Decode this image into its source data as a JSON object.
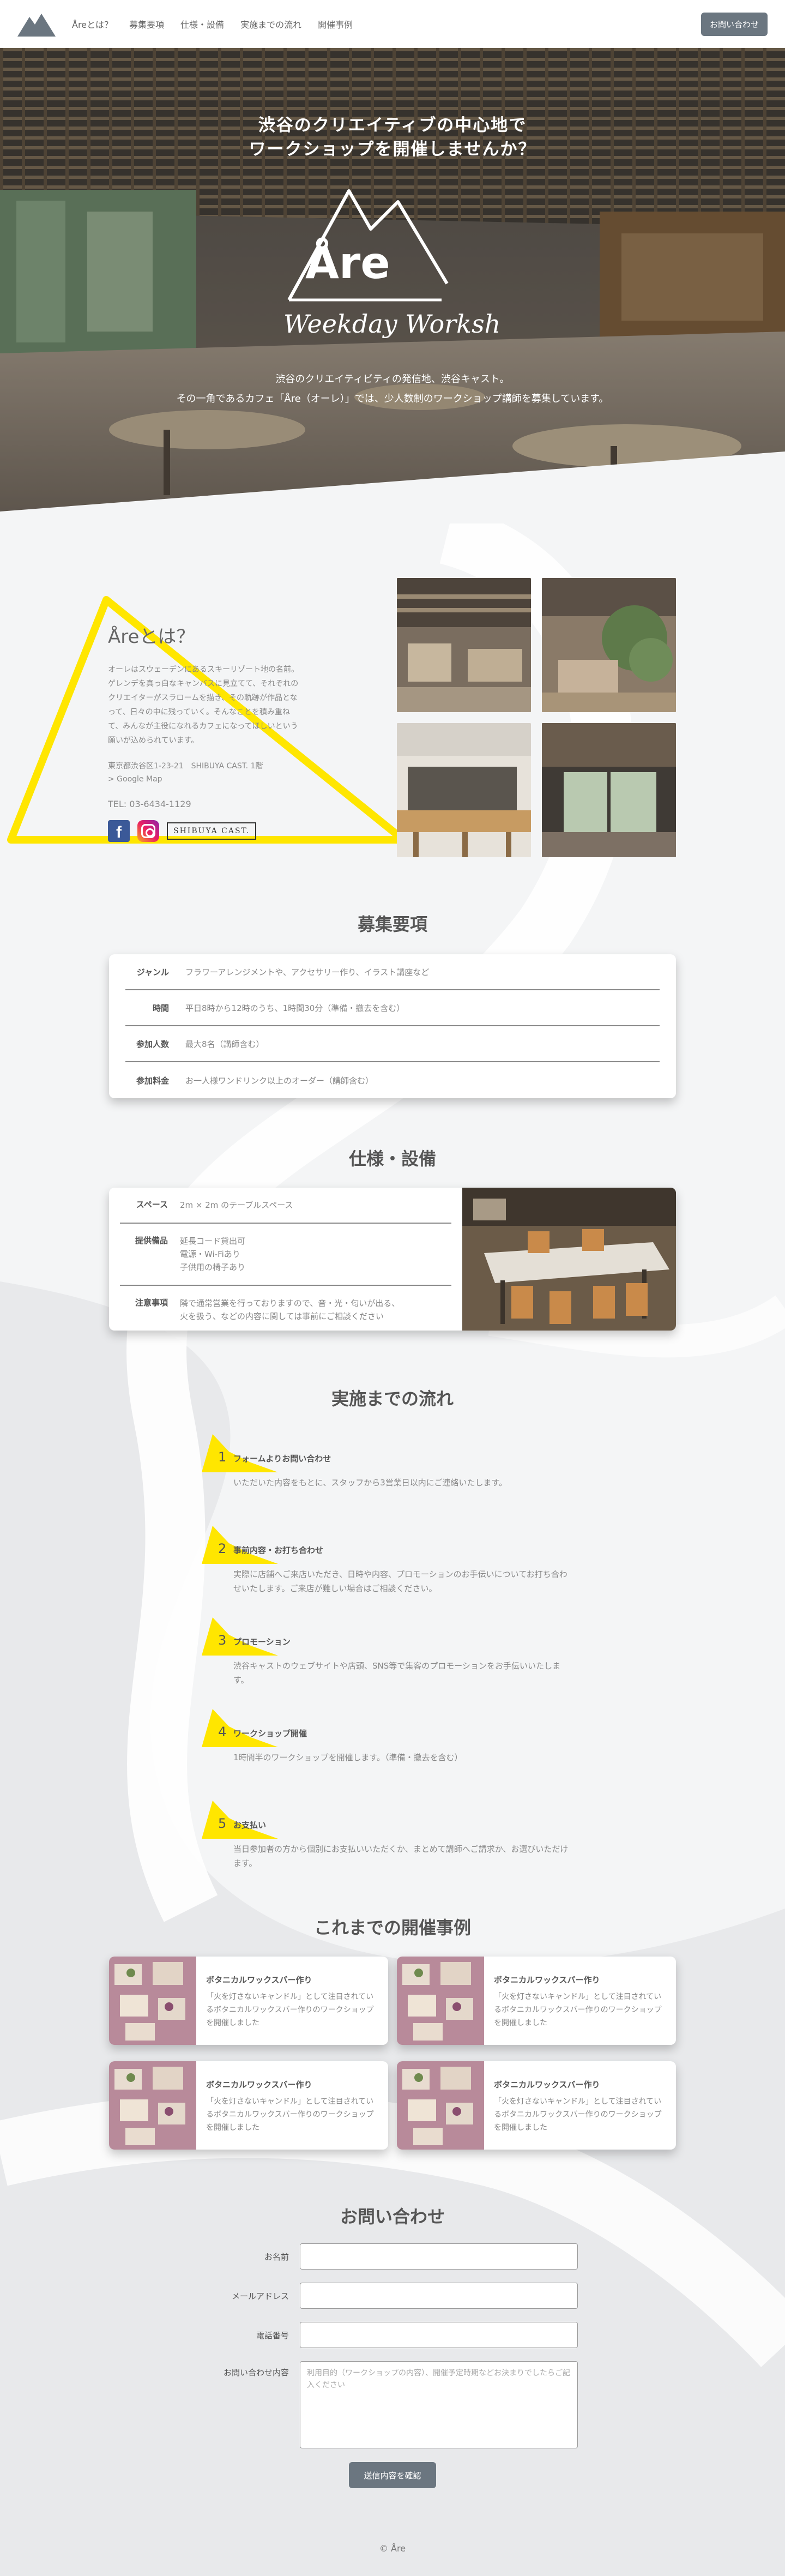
{
  "header": {
    "logo": "mountain-logo",
    "nav": [
      "Åreとは？",
      "募集要項",
      "仕様・設備",
      "実施までの流れ",
      "開催事例"
    ],
    "contact_button": "お問い合わせ"
  },
  "hero": {
    "title_line1": "渋谷のクリエイティブの中心地で",
    "title_line2": "ワークショップを開催しませんか？",
    "emblem_name": "Åre",
    "emblem_sub": "Weekday Workshop",
    "desc_line1": "渋谷のクリエイティビティの発信地、渋谷キャスト。",
    "desc_line2": "その一角であるカフェ「Åre（オーレ）」では、少人数制のワークショップ講師を募集しています。"
  },
  "about": {
    "title": "Åreとは？",
    "body": "オーレはスウェーデンにあるスキーリゾート地の名前。ゲレンデを真っ白なキャンバスに見立てて、それぞれのクリエイターがスラロームを描き、その軌跡が作品となって、日々の中に残っていく。そんなことを積み重ねて、みんなが主役になれるカフェになってほしいという願いが込められています。",
    "address": "東京都渋谷区1-23-21　SHIBUYA CAST. 1階",
    "map_link": "> Google Map",
    "tel": "TEL: 03-6434-1129",
    "social": [
      "facebook-icon",
      "instagram-icon"
    ],
    "badge": "SHIBUYA CAST."
  },
  "recruit": {
    "title": "募集要項",
    "rows": [
      {
        "label": "ジャンル",
        "value": "フラワーアレンジメントや、アクセサリー作り、イラスト講座など"
      },
      {
        "label": "時間",
        "value": "平日8時から12時のうち、1時間30分（準備・撤去を含む）"
      },
      {
        "label": "参加人数",
        "value": "最大8名（講師含む）"
      },
      {
        "label": "参加料金",
        "value": "お一人様ワンドリンク以上のオーダー（講師含む）"
      }
    ]
  },
  "spec": {
    "title": "仕様・設備",
    "rows": [
      {
        "label": "スペース",
        "lines": [
          "2m × 2m のテーブルスペース"
        ]
      },
      {
        "label": "提供備品",
        "lines": [
          "延長コード貸出可",
          "電源・Wi-Fiあり",
          "子供用の椅子あり"
        ]
      },
      {
        "label": "注意事項",
        "lines": [
          "隣で通常営業を行っておりますので、音・光・匂いが出る、",
          "火を扱う、などの内容に関しては事前にご相談ください"
        ]
      }
    ]
  },
  "flow": {
    "title": "実施までの流れ",
    "steps": [
      {
        "num": "1",
        "name": "フォームよりお問い合わせ",
        "desc": "いただいた内容をもとに、スタッフから3営業日以内にご連絡いたします。"
      },
      {
        "num": "2",
        "name": "事前内容・お打ち合わせ",
        "desc": "実際に店舗へご来店いただき、日時や内容、プロモーションのお手伝いについてお打ち合わせいたします。ご来店が難しい場合はご相談ください。"
      },
      {
        "num": "3",
        "name": "プロモーション",
        "desc": "渋谷キャストのウェブサイトや店頭、SNS等で集客のプロモーションをお手伝いいたします。"
      },
      {
        "num": "4",
        "name": "ワークショップ開催",
        "desc": "1時間半のワークショップを開催します。（準備・撤去を含む）"
      },
      {
        "num": "5",
        "name": "お支払い",
        "desc": "当日参加者の方から個別にお支払いいただくか、まとめて講師へご請求か、お選びいただけます。"
      }
    ]
  },
  "cases": {
    "title": "これまでの開催事例",
    "items": [
      {
        "title": "ボタニカルワックスバー作り",
        "desc": "「火を灯さないキャンドル」として注目されているボタニカルワックスバー作りのワークショップを開催しました"
      },
      {
        "title": "ボタニカルワックスバー作り",
        "desc": "「火を灯さないキャンドル」として注目されているボタニカルワックスバー作りのワークショップを開催しました"
      },
      {
        "title": "ボタニカルワックスバー作り",
        "desc": "「火を灯さないキャンドル」として注目されているボタニカルワックスバー作りのワークショップを開催しました"
      },
      {
        "title": "ボタニカルワックスバー作り",
        "desc": "「火を灯さないキャンドル」として注目されているボタニカルワックスバー作りのワークショップを開催しました"
      }
    ]
  },
  "contact": {
    "title": "お問い合わせ",
    "name_label": "お名前",
    "email_label": "メールアドレス",
    "phone_label": "電話番号",
    "message_label": "お問い合わせ内容",
    "message_placeholder": "利用目的（ワークショップの内容）、開催予定時期などお決まりでしたらご記入ください",
    "submit": "送信内容を確認"
  },
  "footer": {
    "text": "© Åre"
  },
  "colors": {
    "accent_yellow": "#ffe600",
    "button_gray": "#6b7680",
    "section_bg": "#f4f5f6"
  }
}
